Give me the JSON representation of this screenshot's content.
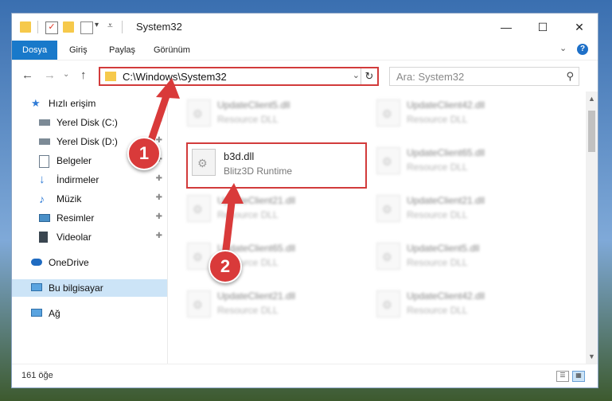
{
  "window": {
    "title": "System32",
    "controls": {
      "minimize": "—",
      "maximize": "☐",
      "close": "✕"
    }
  },
  "ribbon": {
    "tabs": [
      "Dosya",
      "Giriş",
      "Paylaş",
      "Görünüm"
    ],
    "expand": "⌄",
    "help": "?"
  },
  "nav": {
    "back": "←",
    "forward": "→",
    "up_history": "⌄",
    "up": "↑",
    "address": "C:\\Windows\\System32",
    "address_dropdown": "⌄",
    "refresh": "↻",
    "search_placeholder": "Ara: System32",
    "search_icon": "⚲"
  },
  "sidebar": {
    "items": [
      {
        "label": "Hızlı erişim",
        "icon": "star-icon",
        "pinned": false
      },
      {
        "label": "Yerel Disk (C:)",
        "icon": "drive-icon",
        "pinned": true
      },
      {
        "label": "Yerel Disk (D:)",
        "icon": "drive-icon",
        "pinned": true
      },
      {
        "label": "Belgeler",
        "icon": "documents-icon",
        "pinned": true
      },
      {
        "label": "İndirmeler",
        "icon": "download-icon",
        "pinned": true
      },
      {
        "label": "Müzik",
        "icon": "music-icon",
        "pinned": true
      },
      {
        "label": "Resimler",
        "icon": "pictures-icon",
        "pinned": true
      },
      {
        "label": "Videolar",
        "icon": "video-icon",
        "pinned": true
      },
      {
        "label": "OneDrive",
        "icon": "cloud-icon",
        "pinned": false
      },
      {
        "label": "Bu bilgisayar",
        "icon": "computer-icon",
        "pinned": false,
        "selected": true
      },
      {
        "label": "Ağ",
        "icon": "network-icon",
        "pinned": false
      }
    ],
    "pin_glyph": "📌"
  },
  "files": [
    {
      "name": "UpdateClient5.dll",
      "desc": "Resource DLL",
      "blurred": true
    },
    {
      "name": "UpdateClient42.dll",
      "desc": "Resource DLL",
      "blurred": true
    },
    {
      "name": "b3d.dll",
      "desc": "Blitz3D Runtime",
      "blurred": false
    },
    {
      "name": "UpdateClient65.dll",
      "desc": "Resource DLL",
      "blurred": true
    },
    {
      "name": "UpdateClient21.dll",
      "desc": "Resource DLL",
      "blurred": true
    },
    {
      "name": "UpdateClient21.dll",
      "desc": "Resource DLL",
      "blurred": true
    },
    {
      "name": "UpdateClient65.dll",
      "desc": "Resource DLL",
      "blurred": true
    },
    {
      "name": "UpdateClient5.dll",
      "desc": "Resource DLL",
      "blurred": true
    },
    {
      "name": "UpdateClient21.dll",
      "desc": "Resource DLL",
      "blurred": true
    },
    {
      "name": "UpdateClient42.dll",
      "desc": "Resource DLL",
      "blurred": true
    }
  ],
  "status": {
    "count": "161 öğe"
  },
  "annotations": {
    "step1": "1",
    "step2": "2",
    "color": "#d93a3a"
  }
}
